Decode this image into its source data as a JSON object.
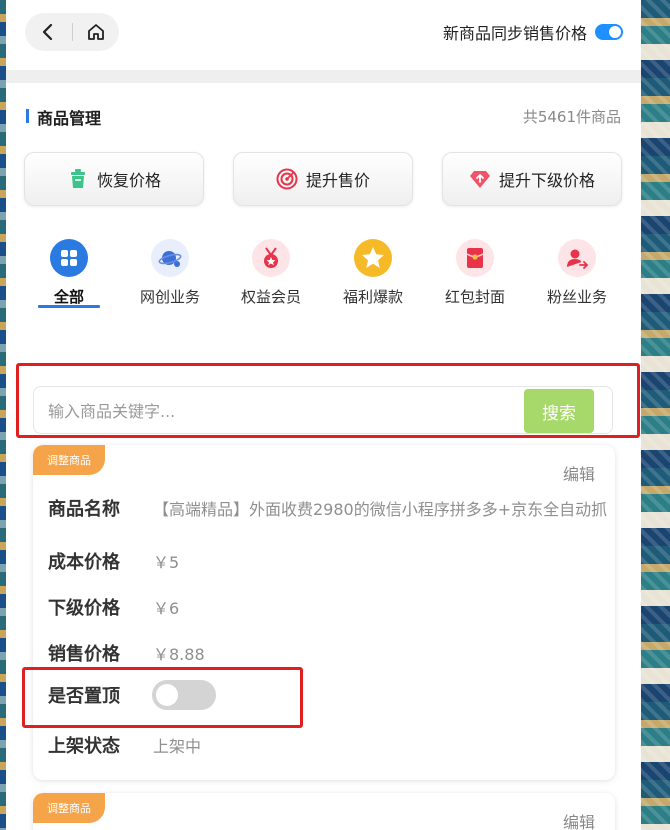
{
  "header": {
    "back_icon": "chevron-left-icon",
    "home_icon": "home-icon",
    "sync_label": "新商品同步销售价格",
    "sync_enabled": true
  },
  "section": {
    "title": "商品管理",
    "count_text": "共5461件商品"
  },
  "actions": [
    {
      "label": "恢复价格",
      "icon": "trash-restore-icon"
    },
    {
      "label": "提升售价",
      "icon": "target-icon"
    },
    {
      "label": "提升下级价格",
      "icon": "diamond-up-icon"
    }
  ],
  "categories": [
    {
      "label": "全部",
      "icon": "grid-icon",
      "active": true
    },
    {
      "label": "网创业务",
      "icon": "planet-icon",
      "active": false
    },
    {
      "label": "权益会员",
      "icon": "medal-icon",
      "active": false
    },
    {
      "label": "福利爆款",
      "icon": "star-icon",
      "active": false
    },
    {
      "label": "红包封面",
      "icon": "red-envelope-icon",
      "active": false
    },
    {
      "label": "粉丝业务",
      "icon": "user-share-icon",
      "active": false
    }
  ],
  "search": {
    "placeholder": "输入商品关键字...",
    "button_label": "搜索"
  },
  "products": [
    {
      "tag": "调整商品",
      "edit_label": "编辑",
      "fields": {
        "name_label": "商品名称",
        "name_value": "【高端精品】外面收费2980的微信小程序拼多多+京东全自动抓",
        "cost_label": "成本价格",
        "cost_value": "￥5",
        "sub_label": "下级价格",
        "sub_value": "￥6",
        "sale_label": "销售价格",
        "sale_value": "￥8.88",
        "pin_label": "是否置顶",
        "pinned": false,
        "status_label": "上架状态",
        "status_value": "上架中"
      }
    },
    {
      "tag": "调整商品",
      "edit_label": "编辑"
    }
  ],
  "colors": {
    "accent": "#2a7ae2",
    "toggle_on": "#1e90ff",
    "search_button": "#a6d86a",
    "tag": "#f5a44a",
    "highlight": "#e02020"
  }
}
